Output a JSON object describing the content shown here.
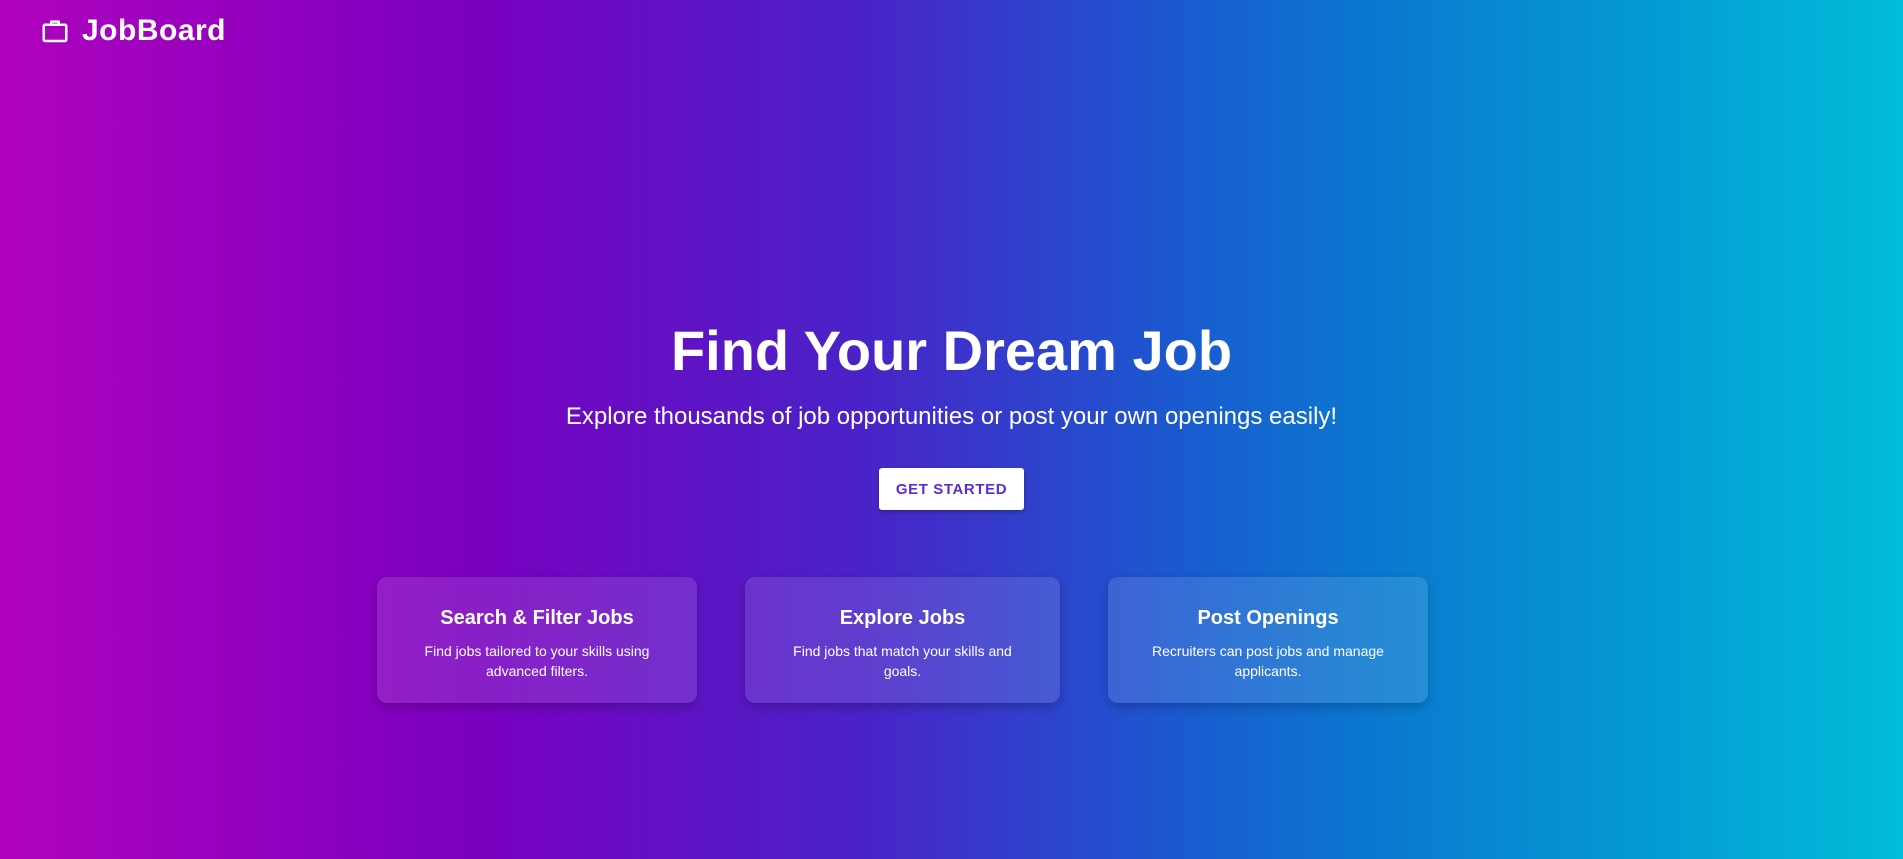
{
  "brand": {
    "name": "JobBoard",
    "icon": "briefcase-icon"
  },
  "hero": {
    "title": "Find Your Dream Job",
    "subtitle": "Explore thousands of job opportunities or post your own openings easily!",
    "cta_label": "GET STARTED"
  },
  "features": [
    {
      "title": "Search & Filter Jobs",
      "description": "Find jobs tailored to your skills using advanced filters."
    },
    {
      "title": "Explore Jobs",
      "description": "Find jobs that match your skills and goals."
    },
    {
      "title": "Post Openings",
      "description": "Recruiters can post jobs and manage applicants."
    }
  ],
  "colors": {
    "gradient_start": "#b002bd",
    "gradient_mid": "#4a22c8",
    "gradient_end": "#00bdd9",
    "cta_text": "#5b2bd6",
    "text": "#ffffff"
  }
}
